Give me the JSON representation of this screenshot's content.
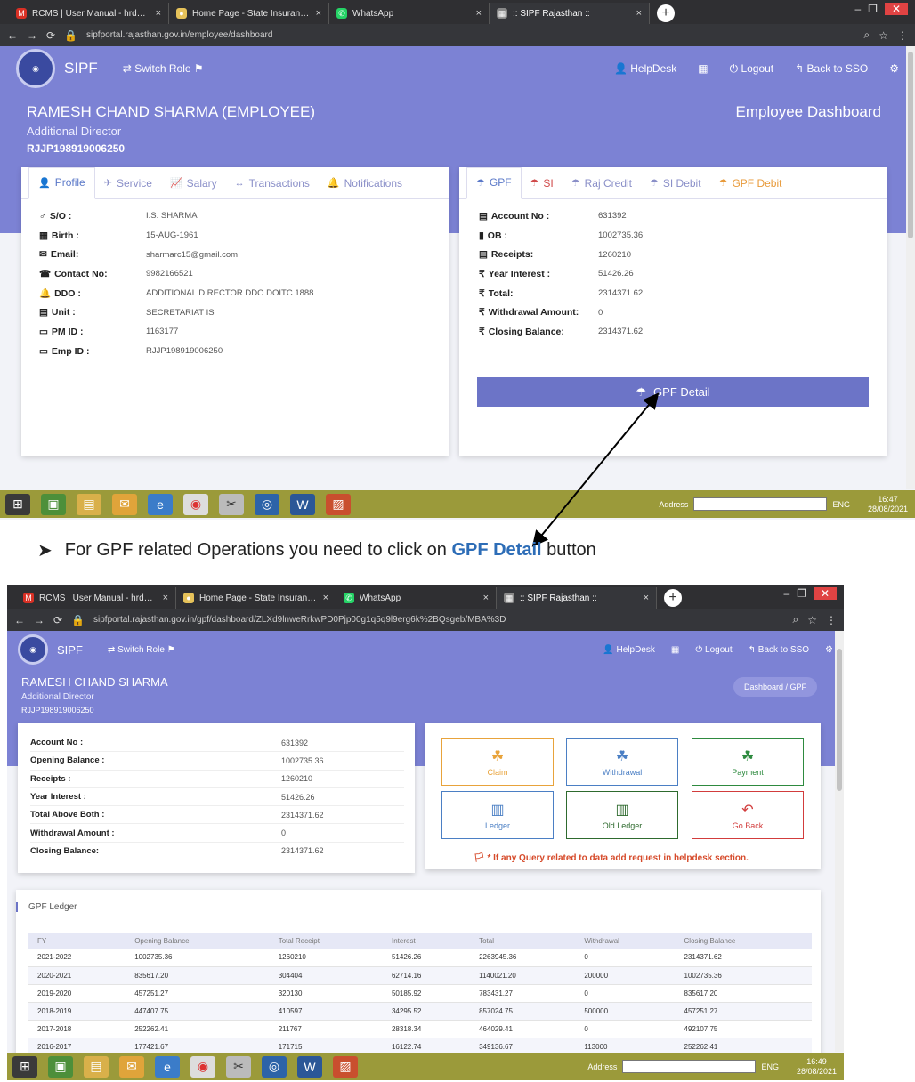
{
  "top": {
    "browser_tabs": [
      {
        "label": "RCMS | User Manual - hrd958@",
        "close": "×",
        "favicon": "M",
        "color": "#d93025"
      },
      {
        "label": "Home Page - State Insurance and",
        "close": "×",
        "favicon": "●",
        "color": "#e6c25a"
      },
      {
        "label": "WhatsApp",
        "close": "×",
        "favicon": "✆",
        "color": "#25d366"
      },
      {
        "label": ":: SIPF Rajasthan ::",
        "close": "×",
        "favicon": "▦",
        "color": "#888888"
      }
    ],
    "new_tab": "+",
    "url": "sipfportal.rajasthan.gov.in/employee/dashboard",
    "app_name": "SIPF",
    "switch_role": "Switch Role",
    "nav": {
      "helpdesk": "HelpDesk",
      "logout": "Logout",
      "back_to_sso": "Back to SSO"
    },
    "employee_name": "RAMESH CHAND SHARMA (EMPLOYEE)",
    "designation": "Additional Director",
    "employee_id": "RJJP198919006250",
    "dashboard_title": "Employee Dashboard",
    "profile_tabs": [
      {
        "label": "Profile",
        "icon": "👤"
      },
      {
        "label": "Service",
        "icon": "✈"
      },
      {
        "label": "Salary",
        "icon": "📈"
      },
      {
        "label": "Transactions",
        "icon": "↔"
      },
      {
        "label": "Notifications",
        "icon": "🔔"
      }
    ],
    "profile_fields": [
      {
        "label": "S/O :",
        "value": "I.S. SHARMA",
        "icon": "♂"
      },
      {
        "label": "Birth :",
        "value": "15-AUG-1961",
        "icon": "▦"
      },
      {
        "label": "Email:",
        "value": "sharmarc15@gmail.com",
        "icon": "✉"
      },
      {
        "label": "Contact No:",
        "value": "9982166521",
        "icon": "☎"
      },
      {
        "label": "DDO :",
        "value": "ADDITIONAL DIRECTOR DDO DOITC 1888",
        "icon": "🔔"
      },
      {
        "label": "Unit :",
        "value": "SECRETARIAT IS",
        "icon": "▤"
      },
      {
        "label": "PM ID :",
        "value": "1163177",
        "icon": "▭"
      },
      {
        "label": "Emp ID :",
        "value": "RJJP198919006250",
        "icon": "▭"
      }
    ],
    "scheme_tabs": [
      {
        "label": "GPF",
        "icon": "☂"
      },
      {
        "label": "SI",
        "icon": "☂"
      },
      {
        "label": "Raj Credit",
        "icon": "☂"
      },
      {
        "label": "SI Debit",
        "icon": "☂"
      },
      {
        "label": "GPF Debit",
        "icon": "☂"
      }
    ],
    "gpf_fields": [
      {
        "label": "Account No :",
        "value": "631392",
        "icon": "▤"
      },
      {
        "label": "OB :",
        "value": "1002735.36",
        "icon": "▮"
      },
      {
        "label": "Receipts:",
        "value": "1260210",
        "icon": "▤"
      },
      {
        "label": "Year Interest :",
        "value": "51426.26",
        "icon": "₹"
      },
      {
        "label": "Total:",
        "value": "2314371.62",
        "icon": "₹"
      },
      {
        "label": "Withdrawal Amount:",
        "value": "0",
        "icon": "₹"
      },
      {
        "label": "Closing Balance:",
        "value": "2314371.62",
        "icon": "₹"
      }
    ],
    "gpf_detail_button": "GPF Detail",
    "taskbar": {
      "address": "Address",
      "lang": "ENG",
      "time": "16:47",
      "date": "28/08/2021"
    }
  },
  "caption": {
    "bullet": "➤",
    "text_before": "For GPF related Operations you need to  click on ",
    "highlight": "GPF Detail",
    "text_after": " button"
  },
  "bottom": {
    "url": "sipfportal.rajasthan.gov.in/gpf/dashboard/ZLXd9lnweRrkwPD0Pjp00g1q5q9l9erg6k%2BQsgeb/MBA%3D",
    "employee_name": "RAMESH CHAND SHARMA",
    "designation": "Additional Director",
    "employee_id": "RJJP198919006250",
    "breadcrumb": "Dashboard / GPF",
    "summary": [
      {
        "label": "Account No :",
        "value": "631392"
      },
      {
        "label": "Opening Balance :",
        "value": "1002735.36"
      },
      {
        "label": "Receipts :",
        "value": "1260210"
      },
      {
        "label": "Year Interest :",
        "value": "51426.26"
      },
      {
        "label": "Total Above Both :",
        "value": "2314371.62"
      },
      {
        "label": "Withdrawal Amount :",
        "value": "0"
      },
      {
        "label": "Closing Balance:",
        "value": "2314371.62"
      }
    ],
    "tiles": [
      {
        "label": "Claim",
        "color": "#e8a33b",
        "icon": "☘"
      },
      {
        "label": "Withdrawal",
        "color": "#4b7fc4",
        "icon": "☘"
      },
      {
        "label": "Payment",
        "color": "#2e8a3f",
        "icon": "☘"
      },
      {
        "label": "Ledger",
        "color": "#4b7fc4",
        "icon": "▥"
      },
      {
        "label": "Old Ledger",
        "color": "#2e6a2e",
        "icon": "▥"
      },
      {
        "label": "Go Back",
        "color": "#d23c3c",
        "icon": "↶"
      }
    ],
    "notice": "* If any Query related to data add request in helpdesk section.",
    "ledger_title": "GPF Ledger",
    "ledger_columns": [
      "FY",
      "Opening Balance",
      "Total Receipt",
      "Interest",
      "Total",
      "Withdrawal",
      "Closing Balance"
    ],
    "ledger_rows": [
      [
        "2021-2022",
        "1002735.36",
        "1260210",
        "51426.26",
        "2263945.36",
        "0",
        "2314371.62"
      ],
      [
        "2020-2021",
        "835617.20",
        "304404",
        "62714.16",
        "1140021.20",
        "200000",
        "1002735.36"
      ],
      [
        "2019-2020",
        "457251.27",
        "320130",
        "50185.92",
        "783431.27",
        "0",
        "835617.20"
      ],
      [
        "2018-2019",
        "447407.75",
        "410597",
        "34295.52",
        "857024.75",
        "500000",
        "457251.27"
      ],
      [
        "2017-2018",
        "252262.41",
        "211767",
        "28318.34",
        "464029.41",
        "0",
        "492107.75"
      ],
      [
        "2016-2017",
        "177421.67",
        "171715",
        "16122.74",
        "349136.67",
        "113000",
        "252262.41"
      ]
    ],
    "taskbar": {
      "address": "Address",
      "lang": "ENG",
      "time": "16:49",
      "date": "28/08/2021"
    }
  }
}
